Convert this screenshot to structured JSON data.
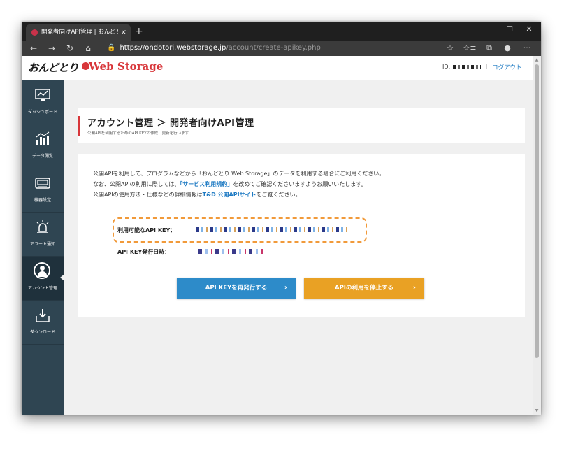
{
  "browser": {
    "tab_title": "開発者向けAPI管理 | おんどとり We",
    "tab_close": "×",
    "new_tab": "+",
    "minimize": "−",
    "maximize": "☐",
    "close": "✕",
    "back": "←",
    "forward": "→",
    "reload": "↻",
    "home": "⌂",
    "lock": "🔒",
    "url_host": "https://ondotori.webstorage.jp",
    "url_path": "/account/create-apikey.php",
    "favorite": "☆",
    "favorites_bar": "☆≡",
    "collections": "⧉",
    "more": "···"
  },
  "header": {
    "logo_jp": "おんどとり",
    "logo_en": "Web Storage",
    "user_id_label": "ID:",
    "logout": "ログアウト",
    "separator": "|"
  },
  "sidebar": {
    "items": [
      {
        "label": "ダッシュボード",
        "icon": "dashboard-icon"
      },
      {
        "label": "データ閲覧",
        "icon": "data-view-icon"
      },
      {
        "label": "機器設定",
        "icon": "device-settings-icon"
      },
      {
        "label": "アラート通知",
        "icon": "alert-icon"
      },
      {
        "label": "アカウント管理",
        "icon": "account-icon"
      },
      {
        "label": "ダウンロード",
        "icon": "download-icon"
      }
    ]
  },
  "page": {
    "title": "アカウント管理 ＞ 開発者向けAPI管理",
    "subtitle": "公開APIを利用するためのAPI KEYの作成、更新を行います",
    "desc_line1": "公開APIを利用して、プログラムなどから「おんどとり Web Storage」のデータを利用する場合にご利用ください。",
    "desc_line2_a": "なお、公開APIの利用に際しては、",
    "desc_line2_link": "「サービス利用規約」",
    "desc_line2_b": "を改めてご確認くださいますようお願いいたします。",
    "desc_line3_a": "公開APIの使用方法・仕様などの詳細情報は",
    "desc_line3_link": "T&D 公開APIサイト",
    "desc_line3_b": "をご覧ください。",
    "api_key_label": "利用可能なAPI KEY：",
    "api_key_issued_label": "API KEY発行日時：",
    "reissue_button": "API KEYを再発行する",
    "stop_button": "APIの利用を停止する",
    "chevron": "›"
  },
  "colors": {
    "brand_red": "#d8363a",
    "sidebar_bg": "#2f4552",
    "button_blue": "#2d8bc9",
    "button_orange": "#e9a124",
    "highlight_orange": "#f19a3a"
  }
}
